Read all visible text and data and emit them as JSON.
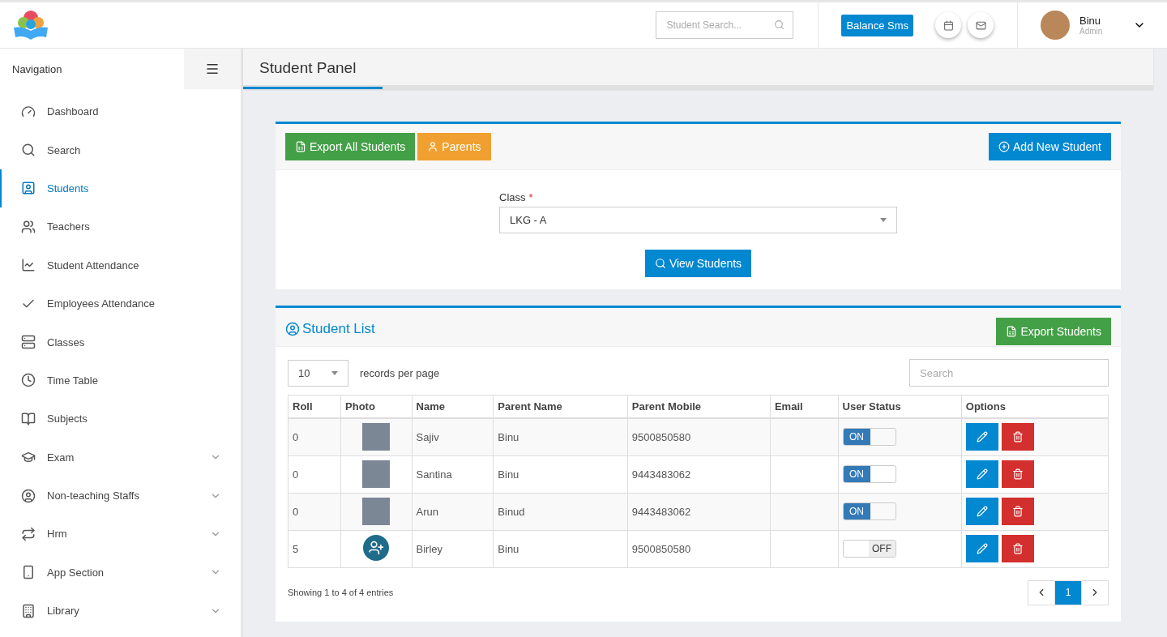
{
  "header": {
    "search": {
      "placeholder": "Student Search..."
    },
    "sms_button": "Balance Sms",
    "user": {
      "name": "Binu",
      "role": "Admin"
    }
  },
  "sidebar": {
    "title": "Navigation",
    "items": [
      {
        "label": "Dashboard",
        "selected": false,
        "expandable": false
      },
      {
        "label": "Search",
        "selected": false,
        "expandable": false
      },
      {
        "label": "Students",
        "selected": true,
        "expandable": false
      },
      {
        "label": "Teachers",
        "selected": false,
        "expandable": false
      },
      {
        "label": "Student Attendance",
        "selected": false,
        "expandable": false
      },
      {
        "label": "Employees Attendance",
        "selected": false,
        "expandable": false
      },
      {
        "label": "Classes",
        "selected": false,
        "expandable": false
      },
      {
        "label": "Time Table",
        "selected": false,
        "expandable": false
      },
      {
        "label": "Subjects",
        "selected": false,
        "expandable": false
      },
      {
        "label": "Exam",
        "selected": false,
        "expandable": true
      },
      {
        "label": "Non-teaching Staffs",
        "selected": false,
        "expandable": true
      },
      {
        "label": "Hrm",
        "selected": false,
        "expandable": true
      },
      {
        "label": "App Section",
        "selected": false,
        "expandable": true
      },
      {
        "label": "Library",
        "selected": false,
        "expandable": true
      }
    ]
  },
  "page_title": "Student Panel",
  "actions": {
    "export_all": "Export All Students",
    "parents": "Parents",
    "add_new": "Add New Student"
  },
  "filter": {
    "label": "Class",
    "required_mark": "*",
    "value": "LKG - A",
    "button": "View Students"
  },
  "student_list": {
    "title": "Student List",
    "export_button": "Export Students",
    "page_size": "10",
    "page_size_label": "records per page",
    "search_placeholder": "Search",
    "columns": [
      "Roll",
      "Photo",
      "Name",
      "Parent Name",
      "Parent Mobile",
      "Email",
      "User Status",
      "Options"
    ],
    "rows": [
      {
        "roll": "0",
        "kind": "photo",
        "name": "Sajiv",
        "parent": "Binu",
        "mobile": "9500850580",
        "status": "ON",
        "on": true
      },
      {
        "roll": "0",
        "kind": "photo",
        "name": "Santina",
        "parent": "Binu",
        "mobile": "9443483062",
        "status": "ON",
        "on": true
      },
      {
        "roll": "0",
        "kind": "photo",
        "name": "Arun",
        "parent": "Binud",
        "mobile": "9443483062",
        "status": "ON",
        "on": true
      },
      {
        "roll": "5",
        "kind": "default",
        "name": "Birley",
        "parent": "Binu",
        "mobile": "9500850580",
        "status": "OFF",
        "on": false
      }
    ],
    "footer": "Showing 1 to 4 of 4 entries",
    "pages": [
      {
        "label": "1",
        "selected": true
      }
    ]
  }
}
